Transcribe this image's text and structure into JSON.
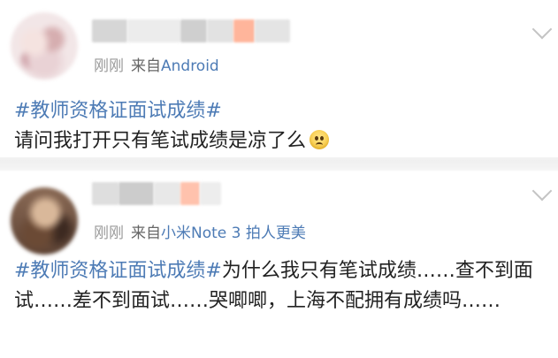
{
  "posts": [
    {
      "time": "刚刚",
      "source_prefix": "来自",
      "device": "Android",
      "topic": "#教师资格证面试成绩#",
      "body": "请问我打开只有笔试成绩是凉了么",
      "emoji_icon": "sad-face-emoji-icon"
    },
    {
      "time": "刚刚",
      "source_prefix": "来自",
      "device": "小米Note 3 拍人更美",
      "topic": "#教师资格证面试成绩#",
      "body": "为什么我只有笔试成绩……查不到面试……差不到面试……哭唧唧，上海不配拥有成绩吗……"
    }
  ],
  "colors": {
    "topic": "#4d7bb5",
    "meta_gray": "#999999",
    "body_text": "#222222"
  }
}
